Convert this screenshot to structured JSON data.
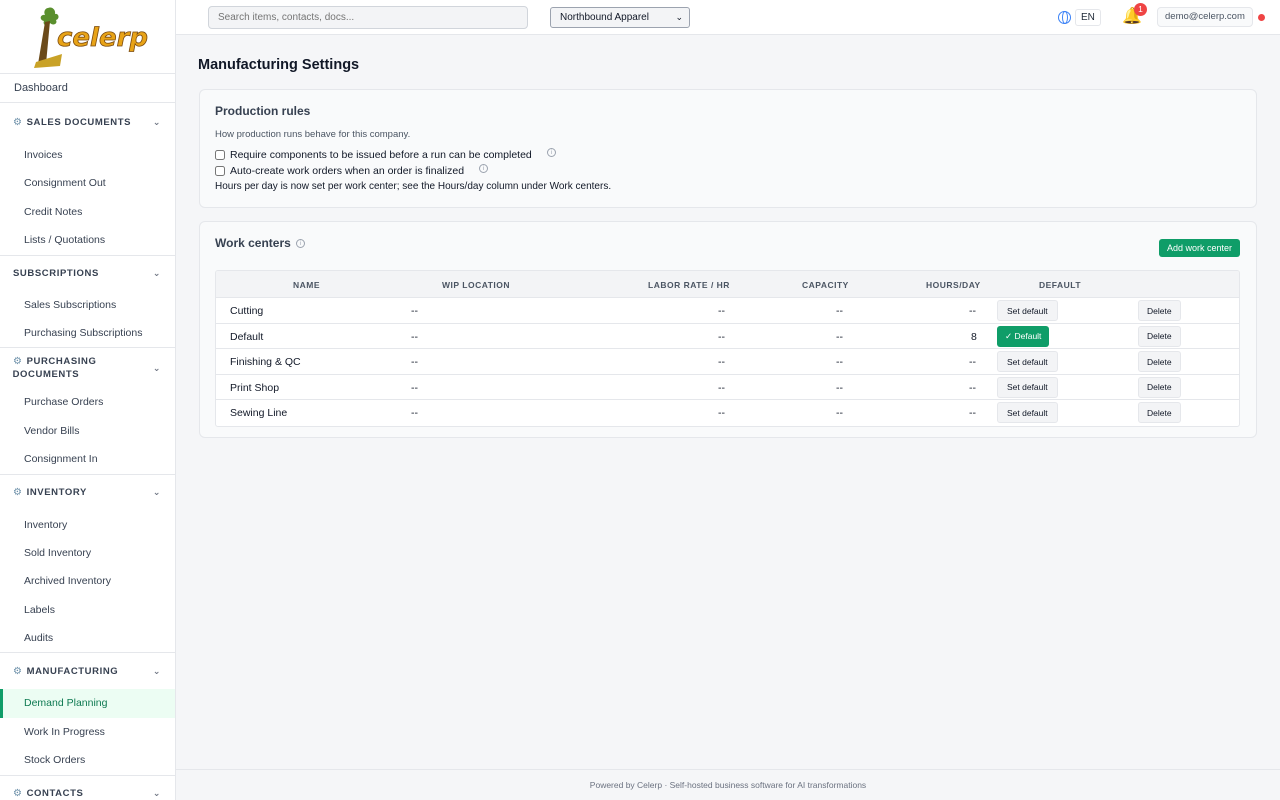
{
  "brand": {
    "logo_text": "celerp",
    "accent": "#0f9d68"
  },
  "sidebar": {
    "dashboard": "Dashboard",
    "sections": [
      {
        "title": "SALES DOCUMENTS",
        "icon": "gear-icon",
        "items": [
          "Invoices",
          "Consignment Out",
          "Credit Notes",
          "Lists / Quotations"
        ]
      },
      {
        "title": "SUBSCRIPTIONS",
        "icon": "",
        "items": [
          "Sales Subscriptions",
          "Purchasing Subscriptions"
        ]
      },
      {
        "title": "PURCHASING DOCUMENTS",
        "title_line1": "PURCHASING",
        "title_line2": "DOCUMENTS",
        "icon": "gear-icon",
        "items": [
          "Purchase Orders",
          "Vendor Bills",
          "Consignment In"
        ]
      },
      {
        "title": "INVENTORY",
        "icon": "gear-icon",
        "items": [
          "Inventory",
          "Sold Inventory",
          "Archived Inventory",
          "Labels",
          "Audits"
        ]
      },
      {
        "title": "MANUFACTURING",
        "icon": "gear-icon",
        "items": [
          "Demand Planning",
          "Work In Progress",
          "Stock Orders"
        ],
        "active": "Demand Planning"
      },
      {
        "title": "CONTACTS",
        "icon": "gear-icon",
        "items": []
      }
    ]
  },
  "topbar": {
    "search_placeholder": "Search items, contacts, docs...",
    "company": "Northbound Apparel",
    "language": "EN",
    "notifications_count": "1",
    "user": "demo@celerp.com"
  },
  "page": {
    "title": "Manufacturing Settings",
    "rules": {
      "title": "Production rules",
      "description": "How production runs behave for this company.",
      "options": [
        {
          "label": "Require components to be issued before a run can be completed",
          "checked": false
        },
        {
          "label": "Auto-create work orders when an order is finalized",
          "checked": false
        }
      ],
      "note": "Hours per day is now set per work center; see the Hours/day column under Work centers."
    },
    "work_centers": {
      "title": "Work centers",
      "add_label": "Add work center",
      "columns": [
        "NAME",
        "WIP LOCATION",
        "LABOR RATE / HR",
        "CAPACITY",
        "HOURS/DAY",
        "DEFAULT"
      ],
      "set_default_label": "Set default",
      "is_default_label": "✓ Default",
      "delete_label": "Delete",
      "rows": [
        {
          "name": "Cutting",
          "wip": "--",
          "labor": "--",
          "capacity": "--",
          "hours": "--",
          "is_default": false
        },
        {
          "name": "Default",
          "wip": "--",
          "labor": "--",
          "capacity": "--",
          "hours": "8",
          "is_default": true
        },
        {
          "name": "Finishing & QC",
          "wip": "--",
          "labor": "--",
          "capacity": "--",
          "hours": "--",
          "is_default": false
        },
        {
          "name": "Print Shop",
          "wip": "--",
          "labor": "--",
          "capacity": "--",
          "hours": "--",
          "is_default": false
        },
        {
          "name": "Sewing Line",
          "wip": "--",
          "labor": "--",
          "capacity": "--",
          "hours": "--",
          "is_default": false
        }
      ]
    }
  },
  "footer": {
    "text": "Powered by Celerp · Self-hosted business software for AI transformations"
  }
}
